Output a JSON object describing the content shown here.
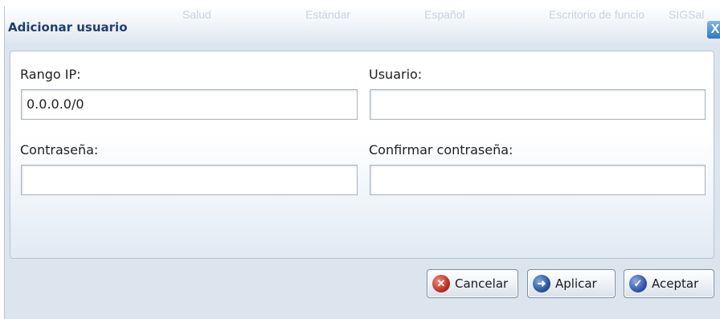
{
  "background_tabs": [
    "Salud",
    "Estándar",
    "Español",
    "Escritorio de funcio",
    "SIGSal"
  ],
  "dialog": {
    "title": "Adicionar usuario",
    "close_label": "X"
  },
  "form": {
    "ip_range_label": "Rango IP:",
    "ip_range_value": "0.0.0.0/0",
    "user_label": "Usuario:",
    "user_value": "",
    "password_label": "Contraseña:",
    "password_value": "",
    "confirm_label": "Confirmar contraseña:",
    "confirm_value": ""
  },
  "buttons": {
    "cancel": "Cancelar",
    "apply": "Aplicar",
    "accept": "Aceptar"
  }
}
